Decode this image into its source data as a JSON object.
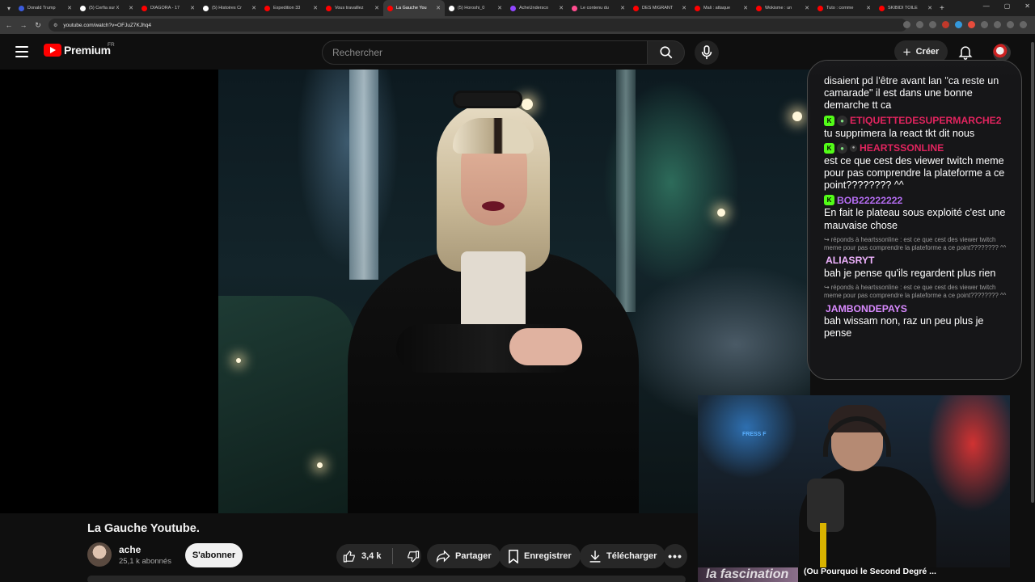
{
  "browser": {
    "tabs": [
      {
        "title": "Donald Trump",
        "color": "#3b5bdb"
      },
      {
        "title": "(5) Cerfia sur X",
        "color": "#ffffff"
      },
      {
        "title": "DIAGORA - 17",
        "color": "#ff0000"
      },
      {
        "title": "(5) Histoires Cr",
        "color": "#ffffff"
      },
      {
        "title": "Expedition 33",
        "color": "#ff0000"
      },
      {
        "title": "Vous travaillez",
        "color": "#ff0000"
      },
      {
        "title": "La Gauche You",
        "color": "#ff0000",
        "active": true
      },
      {
        "title": "(5) Horoshi_0",
        "color": "#ffffff"
      },
      {
        "title": "AcheUndersco",
        "color": "#9146ff"
      },
      {
        "title": "Le contenu du",
        "color": "#ff4d8f"
      },
      {
        "title": "DES MIGRANT",
        "color": "#ff0000"
      },
      {
        "title": "Mali : attaque",
        "color": "#ff0000"
      },
      {
        "title": "Wokisme : un",
        "color": "#ff0000"
      },
      {
        "title": "Tuto : comme",
        "color": "#ff0000"
      },
      {
        "title": "SKIBIDI TOILE",
        "color": "#ff0000"
      }
    ],
    "url": "youtube.com/watch?v=OFJuZ7KJhq4"
  },
  "header": {
    "logo_text": "Premium",
    "country_code": "FR",
    "search_placeholder": "Rechercher",
    "create_label": "Créer"
  },
  "chat": {
    "top_partial": "disaient pd l'être avant lan \"ca reste un camarade\" il est dans une bonne demarche tt ca",
    "messages": [
      {
        "user": "ETIQUETTEDESUPERMARCHE2",
        "color": "#e0245e",
        "badges": [
          "k",
          "a"
        ],
        "text": "tu supprimera la react tkt dit nous"
      },
      {
        "user": "HEARTSSONLINE",
        "color": "#e0245e",
        "badges": [
          "k",
          "a",
          "s"
        ],
        "text": "est ce que cest des viewer twitch meme pour pas comprendre la plateforme a ce point???????? ^^"
      },
      {
        "user": "BOB22222222",
        "color": "#b36cf0",
        "badges": [
          "k"
        ],
        "text": "En fait le plateau sous exploité c'est une mauvaise chose"
      },
      {
        "reply": "↪ réponds à heartssonline : est ce que cest des viewer twitch meme pour pas comprendre la plateforme a ce point???????? ^^",
        "user": "ALIASRYT",
        "color": "#f0b3ff",
        "badges": [],
        "text": "bah je pense qu'ils regardent plus rien"
      },
      {
        "reply": "↪ réponds à heartssonline : est ce que cest des viewer twitch meme pour pas comprendre la plateforme a ce point???????? ^^",
        "user": "JAMBONDEPAYS",
        "color": "#d98aff",
        "badges": [],
        "text": "bah wissam non, raz un peu plus je pense"
      }
    ]
  },
  "overlay": {
    "webcam_text": "FRESS F",
    "bottom_left": "la fascination",
    "bottom_right": "(Ou Pourquoi le Second Degré ..."
  },
  "video": {
    "title": "La Gauche Youtube.",
    "channel": "ache",
    "subscribers": "25,1 k abonnés",
    "subscribe_label": "S'abonner",
    "likes": "3,4 k",
    "share_label": "Partager",
    "save_label": "Enregistrer",
    "download_label": "Télécharger"
  }
}
